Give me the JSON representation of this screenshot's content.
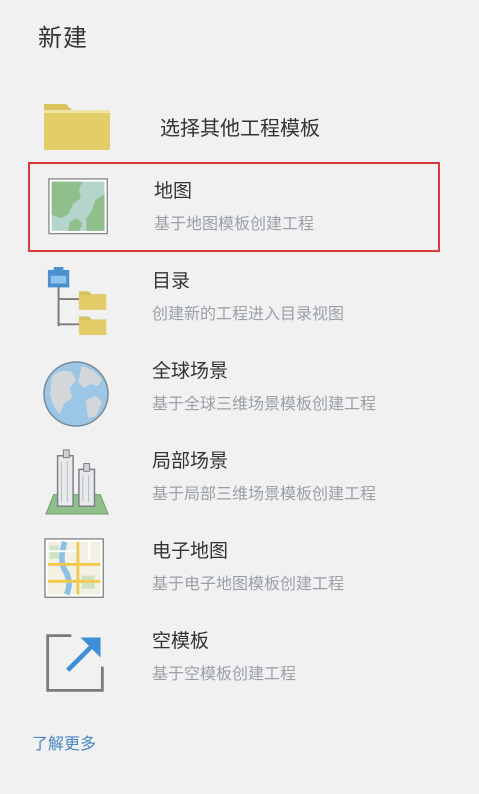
{
  "title": "新建",
  "other_templates": {
    "label": "选择其他工程模板",
    "icon": "folder-icon"
  },
  "items": [
    {
      "label": "地图",
      "desc": "基于地图模板创建工程",
      "icon": "map-icon",
      "selected": true
    },
    {
      "label": "目录",
      "desc": "创建新的工程进入目录视图",
      "icon": "catalog-icon",
      "selected": false
    },
    {
      "label": "全球场景",
      "desc": "基于全球三维场景模板创建工程",
      "icon": "globe-icon",
      "selected": false
    },
    {
      "label": "局部场景",
      "desc": "基于局部三维场景模板创建工程",
      "icon": "buildings-icon",
      "selected": false
    },
    {
      "label": "电子地图",
      "desc": "基于电子地图模板创建工程",
      "icon": "street-map-icon",
      "selected": false
    },
    {
      "label": "空模板",
      "desc": "基于空模板创建工程",
      "icon": "blank-template-icon",
      "selected": false
    }
  ],
  "learn_more": "了解更多",
  "colors": {
    "selection_border": "#d73b3b",
    "link": "#4a86c5"
  }
}
